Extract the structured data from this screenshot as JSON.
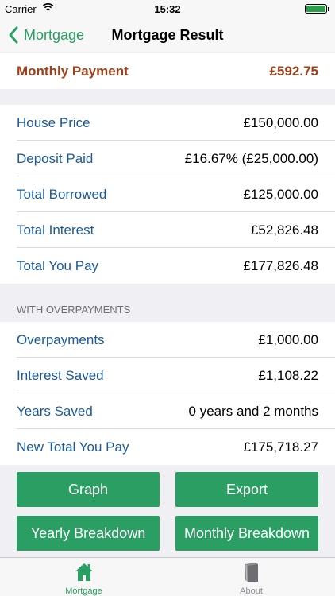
{
  "status_bar": {
    "carrier": "Carrier",
    "time": "15:32",
    "battery_percent": 100
  },
  "nav": {
    "back_label": "Mortgage",
    "title": "Mortgage Result"
  },
  "monthly_payment": {
    "label": "Monthly Payment",
    "value": "£592.75"
  },
  "summary": [
    {
      "label": "House Price",
      "value": "£150,000.00"
    },
    {
      "label": "Deposit Paid",
      "value": "£16.67% (£25,000.00)"
    },
    {
      "label": "Total Borrowed",
      "value": "£125,000.00"
    },
    {
      "label": "Total Interest",
      "value": "£52,826.48"
    },
    {
      "label": "Total You Pay",
      "value": "£177,826.48"
    }
  ],
  "overpayments_section": {
    "header": "WITH OVERPAYMENTS",
    "rows": [
      {
        "label": "Overpayments",
        "value": "£1,000.00"
      },
      {
        "label": "Interest Saved",
        "value": "£1,108.22"
      },
      {
        "label": "Years Saved",
        "value": "0 years and 2 months"
      },
      {
        "label": "New Total You Pay",
        "value": "£175,718.27"
      }
    ]
  },
  "buttons": {
    "graph": "Graph",
    "export": "Export",
    "yearly": "Yearly Breakdown",
    "monthly": "Monthly Breakdown"
  },
  "tabs": [
    {
      "label": "Mortgage",
      "icon": "home-icon",
      "active": true
    },
    {
      "label": "About",
      "icon": "book-icon",
      "active": false
    }
  ],
  "colors": {
    "accent": "#2a9e63",
    "label_blue": "#1a5a9a",
    "monthly_red": "#a0401a",
    "background": "#efeff4"
  }
}
